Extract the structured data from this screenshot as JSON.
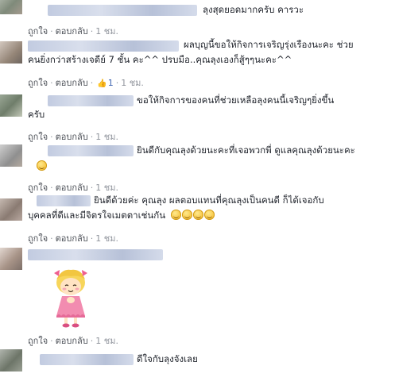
{
  "comments": [
    {
      "text_lines": [
        "ลุงสุดยอดมากครับ คารวะ"
      ],
      "like": "ถูกใจ",
      "reply": "ตอบกลับ",
      "time": "1 ชม."
    },
    {
      "text_lines": [
        "ผลบุญนี้ขอให้กิจการเจริญรุ่งเรืองนะคะ ช่วย",
        "คนยิ่งกว่าสร้างเจดีย์ 7 ชั้น คะ^^ ปรบมือ..คุณลุงเองก็สู้ๆๆนะคะ^^"
      ],
      "like": "ถูกใจ",
      "reply": "ตอบกลับ",
      "likes_count": "1",
      "time": "1 ชม."
    },
    {
      "text_lines": [
        "ขอให้กิจการของคนที่ช่วยเหลือลุงคนนี้เจริญๆยิ่งขึ้น",
        "ครับ"
      ],
      "like": "ถูกใจ",
      "reply": "ตอบกลับ",
      "time": "1 ชม."
    },
    {
      "text_lines": [
        "ยินดีกับคุณลุงด้วยนะคะที่เจอพวกพี่ ดูแลคุณลุงด้วยนะคะ"
      ],
      "like": "ถูกใจ",
      "reply": "ตอบกลับ",
      "time": "1 ชม."
    },
    {
      "text_lines": [
        "ยินดีด้วยค่ะ คุณลุง ผลตอบแทนที่คุณลุงเป็นคนดี ก็ได้เจอกับ",
        "บุคคลที่ดีและมีจิตรใจเมตตาเช่นกัน"
      ],
      "like": "ถูกใจ",
      "reply": "ตอบกลับ",
      "time": "1 ชม."
    },
    {
      "sticker": "sally-sticker",
      "like": "ถูกใจ",
      "reply": "ตอบกลับ",
      "time": "1 ชม."
    },
    {
      "text_lines": [
        "ดีใจกับลุงจังเลย"
      ]
    }
  ],
  "colors": {
    "link": "#4267b2",
    "meta": "#90949c",
    "text": "#1d2129"
  }
}
